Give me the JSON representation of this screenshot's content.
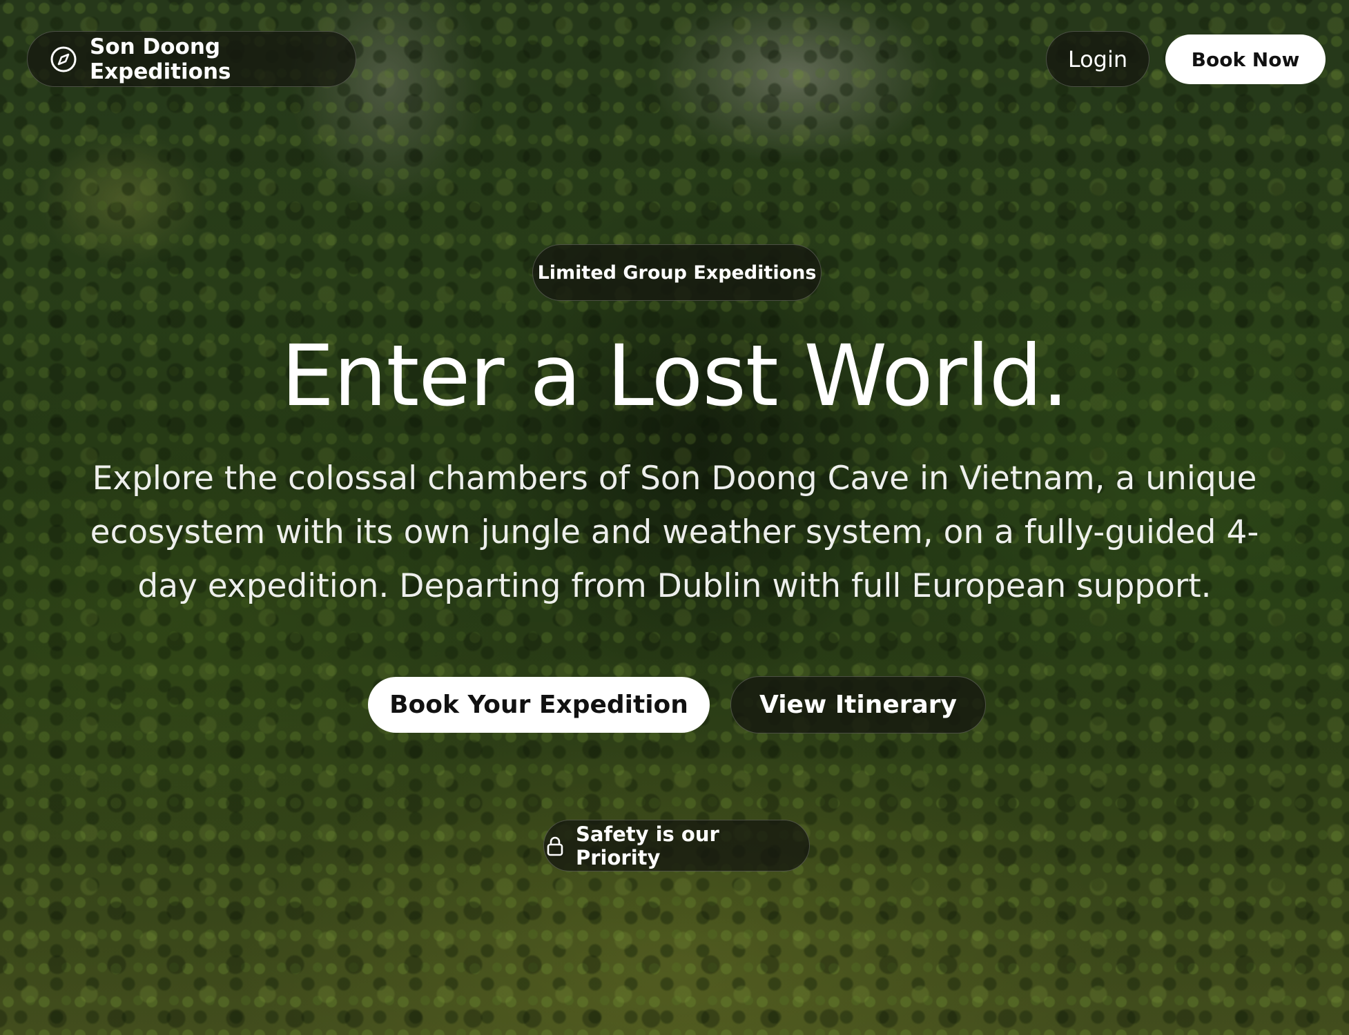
{
  "nav": {
    "brand_label": "Son Doong Expeditions",
    "brand_icon": "compass-icon",
    "login_label": "Login",
    "book_now_label": "Book Now"
  },
  "hero": {
    "tag_label": "Limited Group Expeditions",
    "headline": "Enter a Lost World.",
    "lead": "Explore the colossal chambers of Son Doong Cave in Vietnam, a unique ecosystem with its own jungle and weather system, on a fully-guided 4-day expedition. Departing from Dublin with full European support.",
    "primary_cta_label": "Book Your Expedition",
    "secondary_cta_label": "View Itinerary"
  },
  "safety": {
    "label": "Safety is our Priority",
    "icon": "lock-icon"
  },
  "colors": {
    "pill_dark": "#16180F",
    "pill_light": "#FFFFFF",
    "text_on_dark": "#FFFFFF",
    "text_on_light": "#111111",
    "jungle_green": "#34501F"
  }
}
